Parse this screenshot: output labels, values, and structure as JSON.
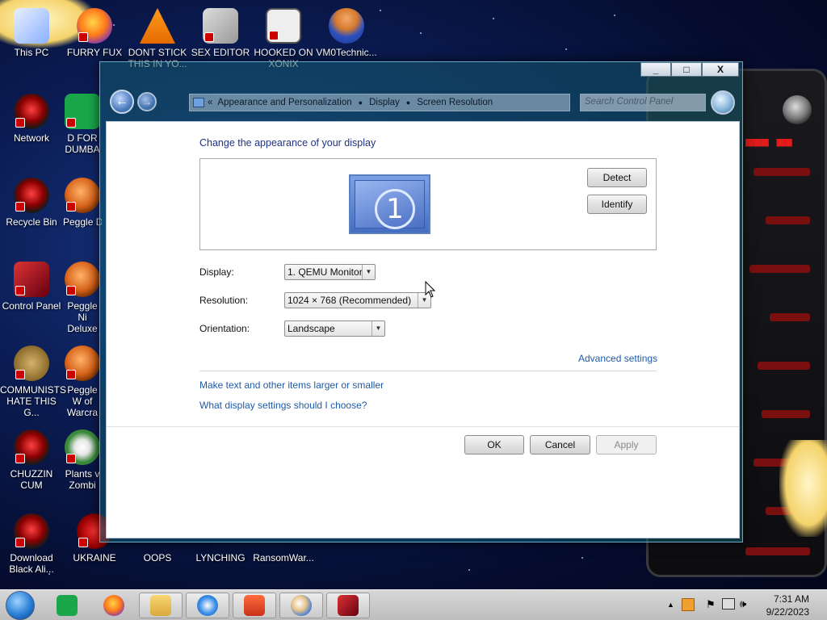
{
  "desktop": {
    "icons": [
      {
        "label": "This PC",
        "icon": "this-pc-icon"
      },
      {
        "label": "Network",
        "icon": "network-icon"
      },
      {
        "label": "Recycle Bin",
        "icon": "recycle-bin-icon"
      },
      {
        "label": "Control Panel",
        "icon": "control-panel-icon"
      },
      {
        "label": "COMMUNISTS HATE THIS G...",
        "icon": "money-bag-icon"
      },
      {
        "label": "CHUZZIN CUM",
        "icon": "chuzzle-icon"
      },
      {
        "label": "Download Black Ali...",
        "icon": "alien-download-icon"
      },
      {
        "label": "FURRY FUX",
        "icon": "firefox-icon"
      },
      {
        "label": "D FOR DUMBA",
        "icon": "notes-app-icon"
      },
      {
        "label": "Peggle De",
        "icon": "peggle-icon"
      },
      {
        "label": "Peggle Ni Deluxe",
        "icon": "peggle-icon"
      },
      {
        "label": "Peggle W of Warcra",
        "icon": "peggle-icon"
      },
      {
        "label": "Plants v Zombi",
        "icon": "flower-icon"
      },
      {
        "label": "UKRAINE",
        "icon": "radiation-icon"
      },
      {
        "label": "DONT STICK THIS IN YO...",
        "icon": "vlc-icon"
      },
      {
        "label": "OOPS",
        "icon": "app-icon"
      },
      {
        "label": "SEX EDITOR",
        "icon": "hex-editor-icon"
      },
      {
        "label": "LYNCHING",
        "icon": "app-icon"
      },
      {
        "label": "HOOKED ON XONIX",
        "icon": "maze-icon"
      },
      {
        "label": "RansomWar...",
        "icon": "app-icon"
      },
      {
        "label": "VM0Technic...",
        "icon": "person-icon"
      }
    ]
  },
  "window": {
    "controls": {
      "minimize": "_",
      "maximize": "□",
      "close": "X"
    },
    "nav": {
      "back_glyph": "←",
      "forward_glyph": "→"
    },
    "breadcrumbs": [
      "Appearance and Personalization",
      "Display",
      "Screen Resolution"
    ],
    "search_placeholder": "Search Control Panel"
  },
  "screen_resolution": {
    "heading": "Change the appearance of your display",
    "monitor_number": "1",
    "detect_label": "Detect",
    "identify_label": "Identify",
    "display_label": "Display:",
    "display_value": "1. QEMU Monitor",
    "resolution_label": "Resolution:",
    "resolution_value": "1024 × 768 (Recommended)",
    "orientation_label": "Orientation:",
    "orientation_value": "Landscape",
    "advanced_link": "Advanced settings",
    "larger_text_link": "Make text and other items larger or smaller",
    "help_link": "What display settings should I choose?",
    "ok_label": "OK",
    "cancel_label": "Cancel",
    "apply_label": "Apply"
  },
  "taskbar": {
    "time": "7:31 AM",
    "date": "9/22/2023"
  }
}
